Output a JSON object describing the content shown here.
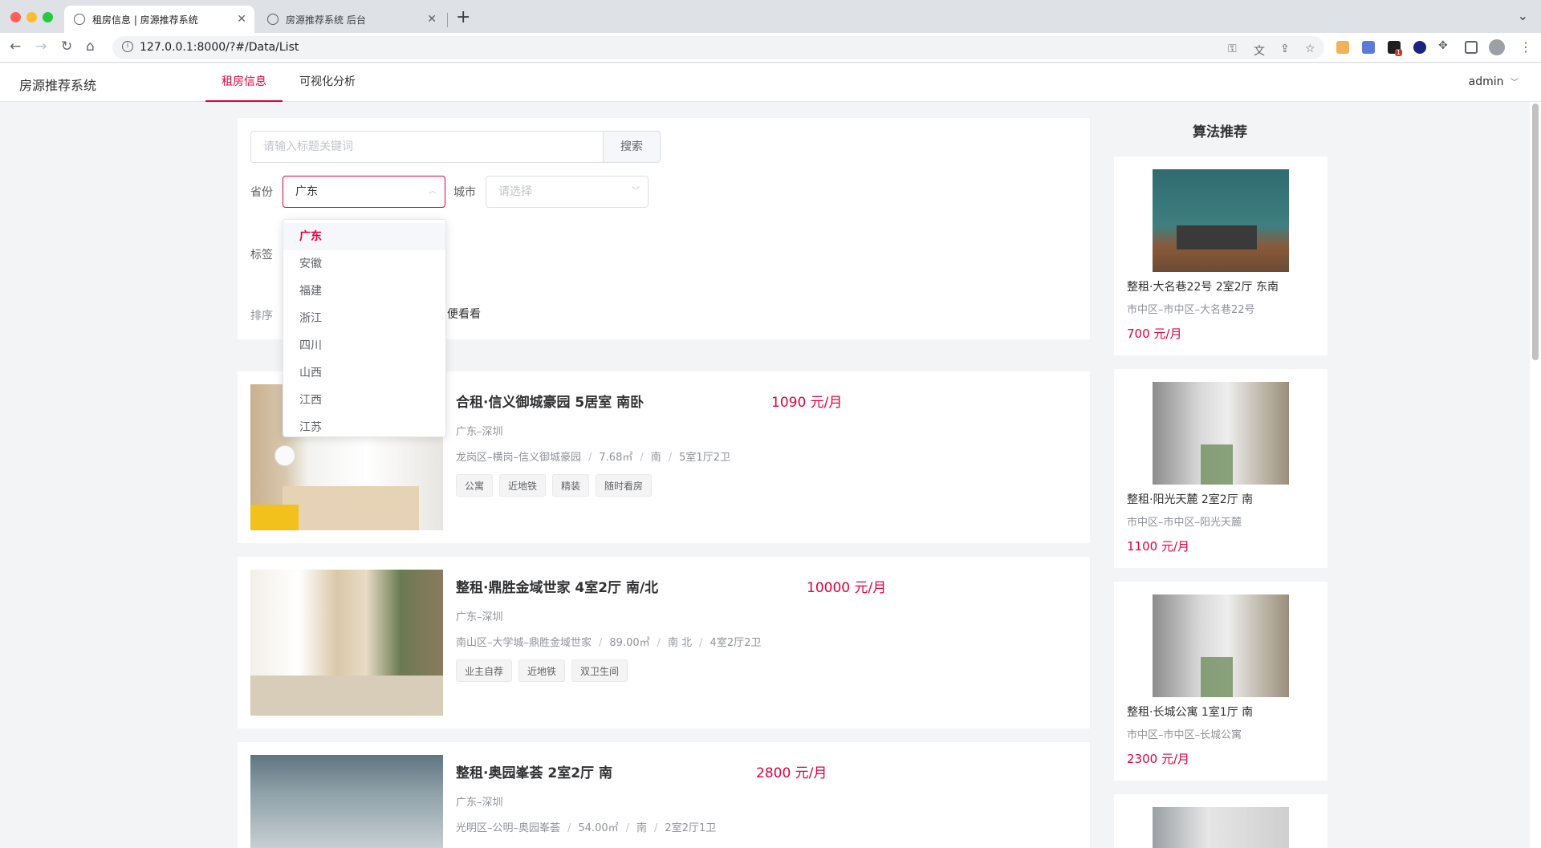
{
  "browser": {
    "tabs": [
      {
        "title": "租房信息 | 房源推荐系统",
        "active": true
      },
      {
        "title": "房源推荐系统 后台",
        "active": false
      }
    ],
    "url": "127.0.0.1:8000/?#/Data/List",
    "extension_badge": "1"
  },
  "header": {
    "brand": "房源推荐系统",
    "nav": [
      {
        "label": "租房信息",
        "active": true
      },
      {
        "label": "可视化分析",
        "active": false
      }
    ],
    "user": "admin"
  },
  "filters": {
    "search_placeholder": "请输入标题关键词",
    "search_button": "搜索",
    "province_label": "省份",
    "province_value": "广东",
    "city_label": "城市",
    "city_placeholder": "请选择",
    "tag_label": "标签",
    "sort_label": "排序",
    "sort_visible_fragment": "便看看",
    "province_options": [
      "广东",
      "安徽",
      "福建",
      "浙江",
      "四川",
      "山西",
      "江西",
      "江苏"
    ],
    "selected_option": "广东"
  },
  "listings": [
    {
      "title": "合租·信义御城豪园 5居室 南卧",
      "price": "1090 元/月",
      "city": "广东–深圳",
      "detail": [
        "龙岗区–横岗–信义御城豪园",
        "7.68㎡",
        "南",
        "5室1厅2卫"
      ],
      "tags": [
        "公寓",
        "近地铁",
        "精装",
        "随时看房"
      ]
    },
    {
      "title": "整租·鼎胜金域世家 4室2厅 南/北",
      "price": "10000 元/月",
      "city": "广东–深圳",
      "detail": [
        "南山区–大学城–鼎胜金域世家",
        "89.00㎡",
        "南 北",
        "4室2厅2卫"
      ],
      "tags": [
        "业主自荐",
        "近地铁",
        "双卫生间"
      ]
    },
    {
      "title": "整租·奥园峯荟 2室2厅 南",
      "price": "2800 元/月",
      "city": "广东–深圳",
      "detail": [
        "光明区–公明–奥园峯荟",
        "54.00㎡",
        "南",
        "2室2厅1卫"
      ],
      "tags": []
    }
  ],
  "recommend": {
    "heading": "算法推荐",
    "items": [
      {
        "title": "整租·大名巷22号 2室2厅 东南",
        "address": "市中区–市中区–大名巷22号",
        "price": "700 元/月"
      },
      {
        "title": "整租·阳光天麓 2室2厅 南",
        "address": "市中区–市中区–阳光天麓",
        "price": "1100 元/月"
      },
      {
        "title": "整租·长城公寓 1室1厅 南",
        "address": "市中区–市中区–长城公寓",
        "price": "2300 元/月"
      }
    ]
  },
  "colors": {
    "accent": "#e4003a",
    "page_bg": "#f3f4f6"
  }
}
